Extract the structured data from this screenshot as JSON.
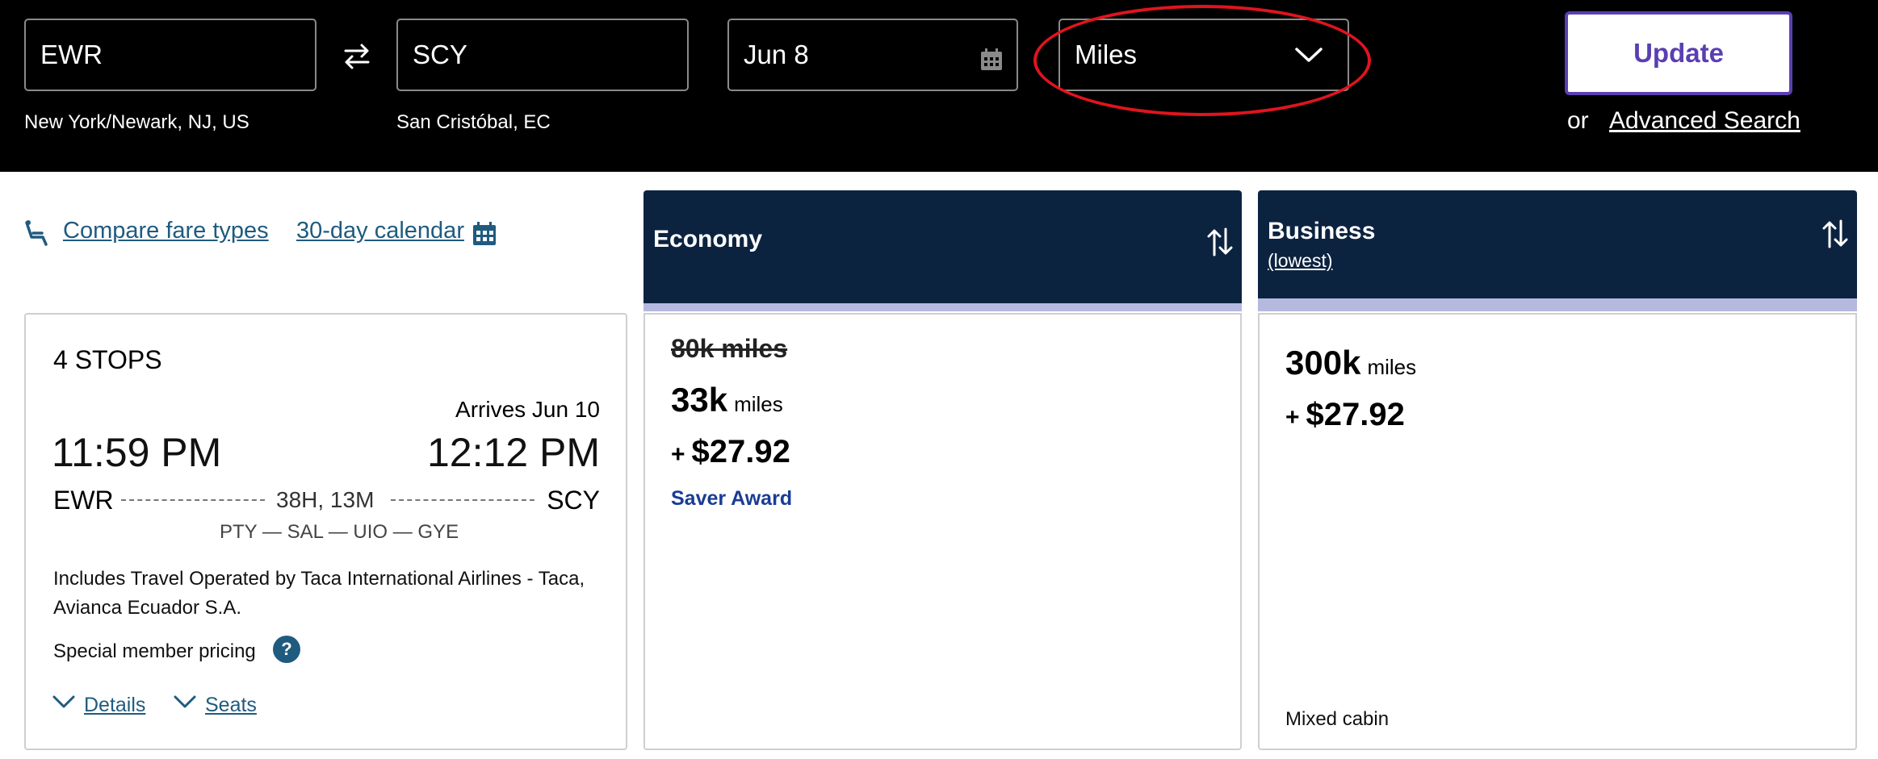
{
  "search": {
    "origin": {
      "code": "EWR",
      "city": "New York/Newark, NJ, US"
    },
    "destination": {
      "code": "SCY",
      "city": "San Cristóbal, EC"
    },
    "date": "Jun 8",
    "fare_type": "Miles",
    "update_label": "Update",
    "or_label": "or",
    "advanced_label": "Advanced Search"
  },
  "links": {
    "compare": "Compare fare types",
    "calendar": "30-day calendar"
  },
  "flight": {
    "stops": "4 STOPS",
    "arrives": "Arrives Jun 10",
    "depart_time": "11:59 PM",
    "arrive_time": "12:12 PM",
    "depart_airport": "EWR",
    "arrive_airport": "SCY",
    "duration": "38H, 13M",
    "route": "PTY — SAL — UIO — GYE",
    "operated_by": "Includes Travel Operated by Taca International Airlines - Taca, Avianca Ecuador S.A.",
    "special_pricing": "Special member pricing",
    "help": "?",
    "details_label": "Details",
    "seats_label": "Seats"
  },
  "fares": {
    "economy": {
      "title": "Economy",
      "original": "80k miles",
      "miles": "33k",
      "unit": "miles",
      "plus": "+",
      "taxes": "$27.92",
      "award": "Saver Award"
    },
    "business": {
      "title": "Business",
      "subtitle": "(lowest)",
      "miles": "300k",
      "unit": "miles",
      "plus": "+",
      "taxes": "$27.92",
      "note": "Mixed cabin"
    }
  },
  "colors": {
    "header_bg": "#000000",
    "fare_header_bg": "#0c2340",
    "fare_stripe": "#b5b9e0",
    "link": "#1f5b7f",
    "update_purple": "#5b3fb1",
    "saver_blue": "#1a3c96",
    "highlight_red": "#e0141e"
  }
}
